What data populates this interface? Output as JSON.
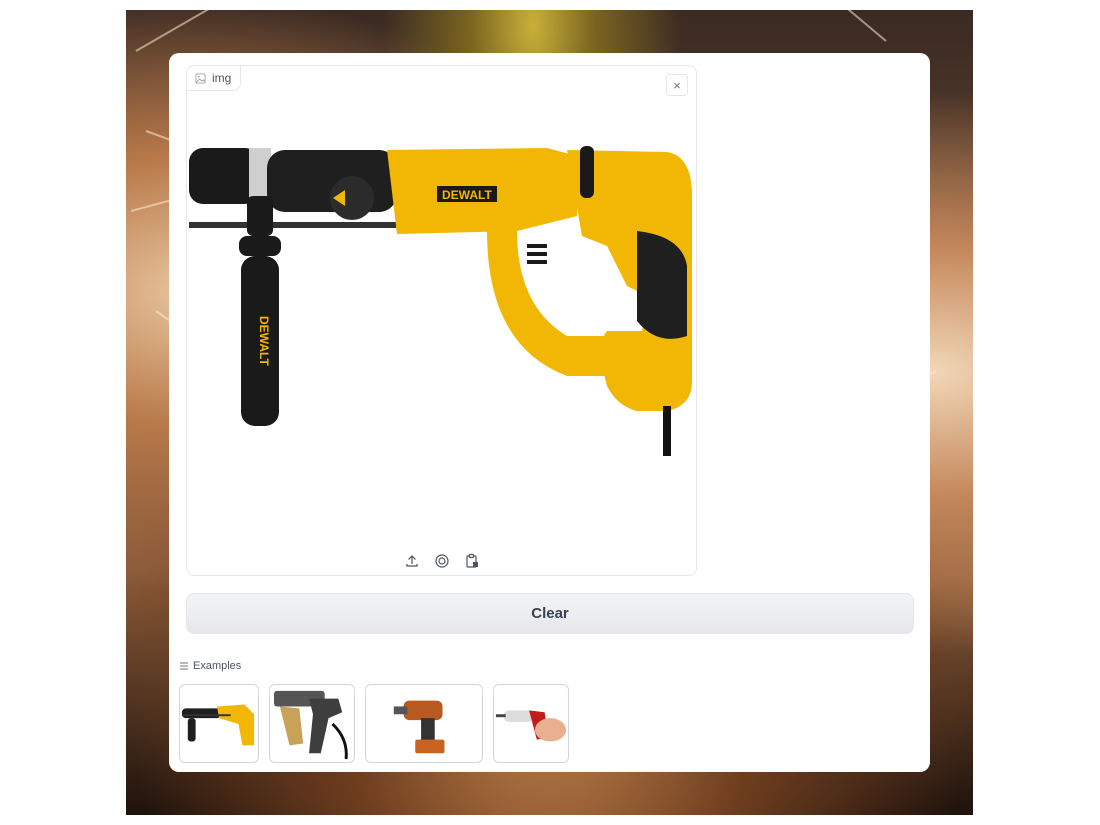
{
  "image_panel": {
    "label": "img",
    "label_icon": "image-icon",
    "clear_icon": "close-icon",
    "source_buttons": [
      "upload-icon",
      "webcam-icon",
      "clipboard-icon"
    ]
  },
  "clear_button": {
    "label": "Clear"
  },
  "examples": {
    "label": "Examples",
    "icon": "list-icon",
    "items": [
      "rotary-hammer-drill",
      "collated-screw-gun",
      "cordless-drill",
      "cordless-screwdriver"
    ]
  },
  "colors": {
    "accent": "#f2b705",
    "button_text": "#374151"
  }
}
